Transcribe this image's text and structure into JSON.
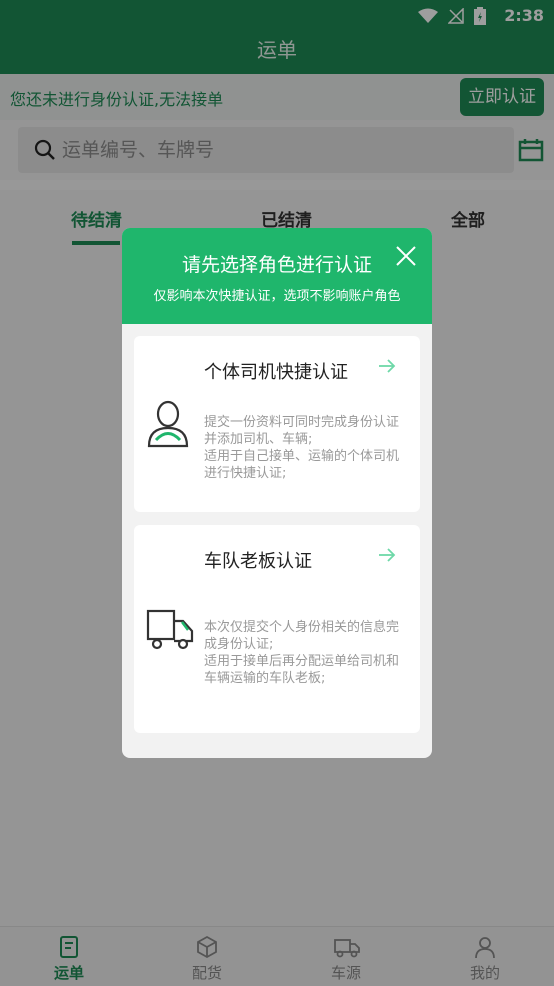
{
  "status_bar": {
    "time": "2:38"
  },
  "header": {
    "title": "运单"
  },
  "notice": {
    "message": "您还未进行身份认证,无法接单",
    "action_label": "立即认证"
  },
  "search": {
    "placeholder": "运单编号、车牌号"
  },
  "tabs": [
    {
      "label": "待结清",
      "active": true
    },
    {
      "label": "已结清",
      "active": false
    },
    {
      "label": "全部",
      "active": false
    }
  ],
  "bottom_nav": [
    {
      "label": "运单",
      "icon": "waybill-icon",
      "active": true
    },
    {
      "label": "配货",
      "icon": "box-icon",
      "active": false
    },
    {
      "label": "车源",
      "icon": "truck-icon",
      "active": false
    },
    {
      "label": "我的",
      "icon": "person-icon",
      "active": false
    }
  ],
  "modal": {
    "title": "请先选择角色进行认证",
    "subtitle": "仅影响本次快捷认证，选项不影响账户角色",
    "cards": [
      {
        "title": "个体司机快捷认证",
        "icon": "driver-icon",
        "desc_lines": [
          "提交一份资料可同时完成身份认证并添加司机、车辆;",
          "适用于自己接单、运输的个体司机进行快捷认证;"
        ]
      },
      {
        "title": "车队老板认证",
        "icon": "truck-icon",
        "desc_lines": [
          "本次仅提交个人身份相关的信息完成身份认证;",
          "适用于接单后再分配运单给司机和车辆运输的车队老板;"
        ]
      }
    ]
  },
  "colors": {
    "brand": "#1d8a55",
    "modal_header": "#1fb66c"
  }
}
